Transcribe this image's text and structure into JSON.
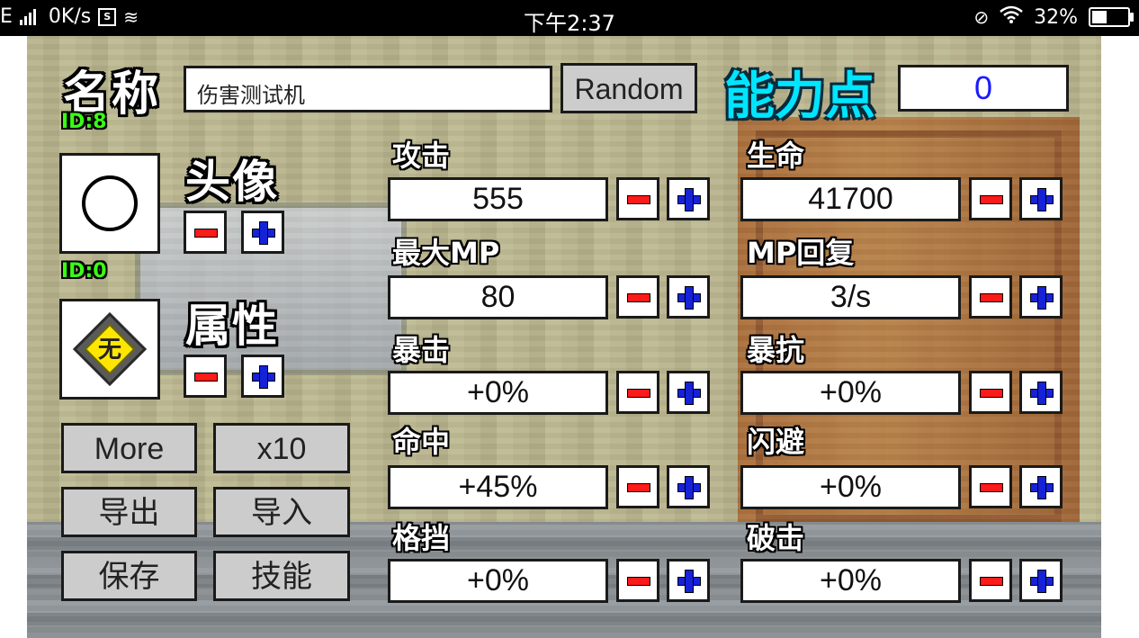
{
  "statusbar": {
    "carrier": "E",
    "speed": "0K/s",
    "time": "下午2:37",
    "battery": "32%"
  },
  "header": {
    "name_label": "名称",
    "name_value": "伤害测试机",
    "random_label": "Random",
    "points_label": "能力点",
    "points_value": "0",
    "id_top": "ID:8"
  },
  "avatar": {
    "label": "头像",
    "id": "ID:0"
  },
  "attribute": {
    "label": "属性",
    "badge": "无"
  },
  "buttons": {
    "more": "More",
    "x10": "x10",
    "export": "导出",
    "import": "导入",
    "save": "保存",
    "skills": "技能"
  },
  "stats": [
    {
      "label": "攻击",
      "value": "555"
    },
    {
      "label": "生命",
      "value": "41700"
    },
    {
      "label": "最大MP",
      "value": "80"
    },
    {
      "label": "MP回复",
      "value": "3/s"
    },
    {
      "label": "暴击",
      "value": "+0%"
    },
    {
      "label": "暴抗",
      "value": "+0%"
    },
    {
      "label": "命中",
      "value": "+45%"
    },
    {
      "label": "闪避",
      "value": "+0%"
    },
    {
      "label": "格挡",
      "value": "+0%"
    },
    {
      "label": "破击",
      "value": "+0%"
    }
  ],
  "colors": {
    "minus": "#ff1a1a",
    "plus": "#1522d8",
    "points_title": "#00e5ff",
    "id_text": "#39ff14"
  }
}
